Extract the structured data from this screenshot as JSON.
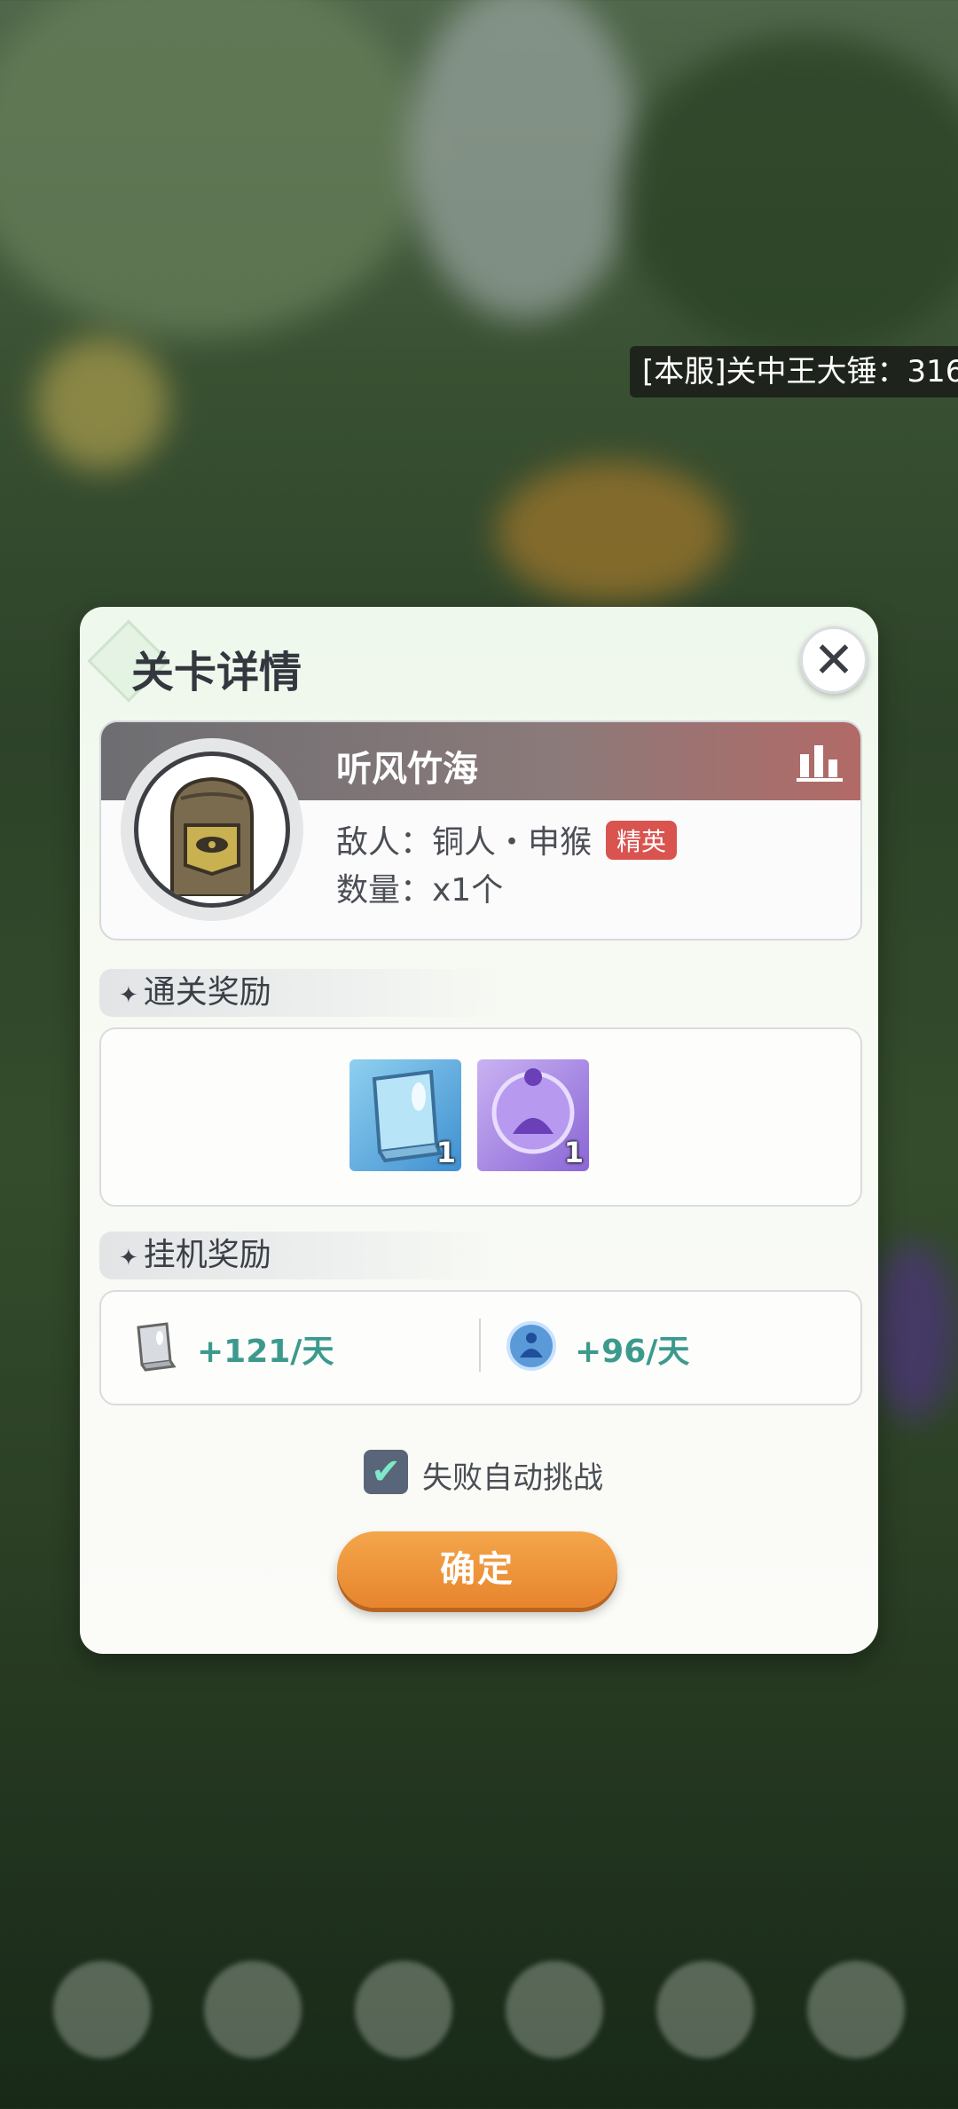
{
  "background": {
    "chat_message": "[本服]关中王大锤：316"
  },
  "dialog": {
    "title": "关卡详情",
    "close_icon": "close-icon",
    "stage": {
      "name": "听风竹海",
      "enemy_text": "敌人：铜人・申猴",
      "elite_label": "精英",
      "count_text": "数量：x1个",
      "rank_icon": "bar-chart-icon"
    },
    "clear_rewards": {
      "header": "通关奖励",
      "items": [
        {
          "icon": "skill-book-icon",
          "qty": "1"
        },
        {
          "icon": "purple-orb-icon",
          "qty": "1"
        }
      ]
    },
    "idle_rewards": {
      "header": "挂机奖励",
      "items": [
        {
          "icon": "silver-book-icon",
          "value": "+121/天"
        },
        {
          "icon": "blue-orb-icon",
          "value": "+96/天"
        }
      ]
    },
    "auto_challenge": {
      "label": "失败自动挑战",
      "checked": true
    },
    "confirm_label": "确定"
  },
  "colors": {
    "accent_orange": "#e7852e",
    "value_teal": "#3c9a8d",
    "elite_red": "#d9534f"
  }
}
